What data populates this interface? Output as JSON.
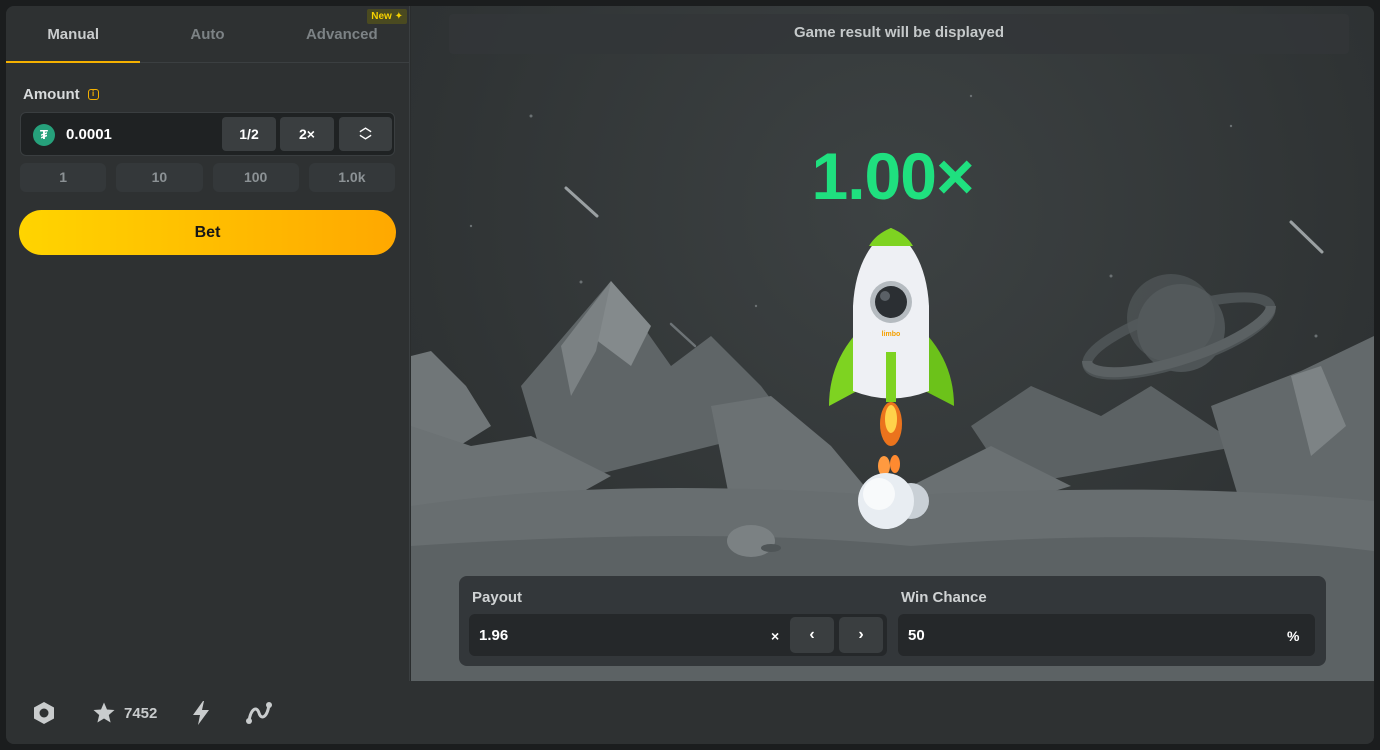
{
  "tabs": [
    {
      "label": "Manual",
      "active": true
    },
    {
      "label": "Auto",
      "active": false
    },
    {
      "label": "Advanced",
      "active": false
    }
  ],
  "new_badge": "New",
  "amount": {
    "label": "Amount",
    "value": "0.0001",
    "half_label": "1/2",
    "double_label": "2×",
    "quick_values": [
      "1",
      "10",
      "100",
      "1.0k"
    ]
  },
  "bet_label": "Bet",
  "game": {
    "result_text": "Game result will be displayed",
    "multiplier": "1.00×",
    "rocket_logo": "limbo"
  },
  "payout": {
    "label": "Payout",
    "value": "1.96",
    "suffix": "×"
  },
  "win_chance": {
    "label": "Win Chance",
    "value": "50",
    "suffix": "%"
  },
  "footer": {
    "icons": [
      "hexagon-settings-icon",
      "star-icon",
      "lightning-icon",
      "route-icon"
    ],
    "star_count": "7452"
  },
  "colors": {
    "accent": "#f5b100",
    "multiplier": "#1fe07f",
    "bet_gradient_start": "#ffd400",
    "bet_gradient_end": "#ffa800",
    "rocket_wing": "#7ed321"
  }
}
